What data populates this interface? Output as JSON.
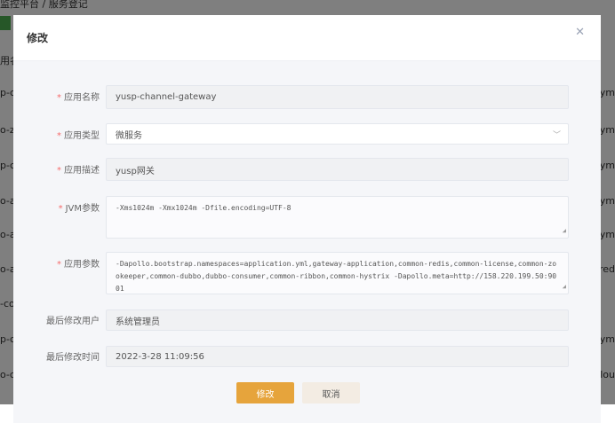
{
  "background": {
    "breadcrumb": "监控平台 / 服务登记",
    "left_fragments": [
      "用名",
      "p-c",
      "o-zj",
      "p-c",
      "o-ap",
      "o-ap",
      "o-au",
      "-co",
      "p-c",
      "o-co"
    ],
    "right_fragments": [
      "on.ym",
      "on.ym",
      "on.ym",
      "on.ym",
      "on.ym",
      "-red",
      "on.ym",
      ".clou"
    ]
  },
  "modal": {
    "title": "修改",
    "close_icon": "close-icon",
    "fields": {
      "name": {
        "label": "应用名称",
        "value": "yusp-channel-gateway",
        "required": true
      },
      "type": {
        "label": "应用类型",
        "value": "微服务",
        "required": true
      },
      "desc": {
        "label": "应用描述",
        "value": "yusp网关",
        "required": true
      },
      "jvm": {
        "label": "JVM参数",
        "value": "-Xms1024m -Xmx1024m -Dfile.encoding=UTF-8",
        "required": true
      },
      "params": {
        "label": "应用参数",
        "value": "-Dapollo.bootstrap.namespaces=application.yml,gateway-application,common-redis,common-license,common-zookeeper,common-dubbo,dubbo-consumer,common-ribbon,common-hystrix -Dapollo.meta=http://158.220.199.50:9001",
        "required": true
      },
      "user": {
        "label": "最后修改用户",
        "value": "系统管理员"
      },
      "time": {
        "label": "最后修改时间",
        "value": "2022-3-28 11:09:56"
      }
    },
    "required_mark": "*",
    "submit_label": "修改",
    "cancel_label": "取消"
  },
  "colors": {
    "primary": "#e6a43c",
    "required": "#f56c6c"
  }
}
